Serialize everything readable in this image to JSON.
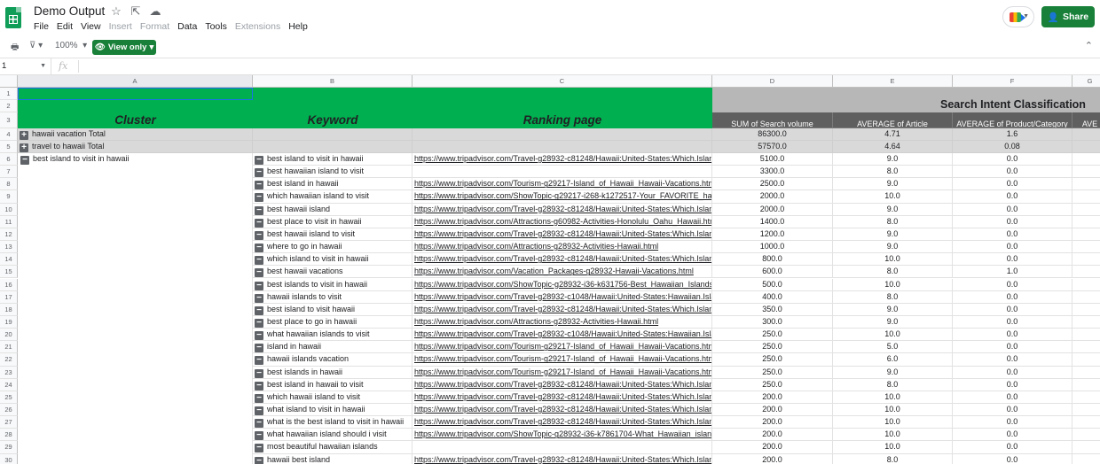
{
  "app": {
    "doc_title": "Demo Output",
    "menus": [
      {
        "label": "File",
        "enabled": true
      },
      {
        "label": "Edit",
        "enabled": true
      },
      {
        "label": "View",
        "enabled": true
      },
      {
        "label": "Insert",
        "enabled": false
      },
      {
        "label": "Format",
        "enabled": false
      },
      {
        "label": "Data",
        "enabled": true
      },
      {
        "label": "Tools",
        "enabled": true
      },
      {
        "label": "Extensions",
        "enabled": false
      },
      {
        "label": "Help",
        "enabled": true
      }
    ],
    "share_label": "Share",
    "accent": "#188038"
  },
  "toolbar": {
    "zoom": "100%",
    "view_only_label": "View only"
  },
  "formula_bar": {
    "name_box": "1",
    "fx": "fx"
  },
  "columns": [
    "A",
    "B",
    "C",
    "D",
    "E",
    "F",
    "G"
  ],
  "headers": {
    "cluster": "Cluster",
    "keyword": "Keyword",
    "ranking_page": "Ranking page",
    "search_intent": "Search Intent Classification",
    "metrics": [
      "SUM of Search volume",
      "AVERAGE of Article",
      "AVERAGE of Product/Category",
      "AVE"
    ]
  },
  "totals": [
    {
      "row": "4",
      "cluster": "hawaii vacation Total",
      "volume": "86300.0",
      "article": "4.71",
      "product": "1.6"
    },
    {
      "row": "5",
      "cluster": "travel to hawaii Total",
      "volume": "57570.0",
      "article": "4.64",
      "product": "0.08"
    }
  ],
  "cluster_name": "best island to visit in hawaii",
  "rows": [
    {
      "row": "6",
      "keyword": "best island to visit in hawaii",
      "page": "https://www.tripadvisor.com/Travel-g28932-c81248/Hawaii:United-States:Which.Islan",
      "volume": "5100.0",
      "article": "9.0",
      "product": "0.0"
    },
    {
      "row": "7",
      "keyword": "best hawaiian island to visit",
      "page": "",
      "volume": "3300.0",
      "article": "8.0",
      "product": "0.0"
    },
    {
      "row": "8",
      "keyword": "best island in hawaii",
      "page": "https://www.tripadvisor.com/Tourism-g29217-Island_of_Hawaii_Hawaii-Vacations.htm",
      "volume": "2500.0",
      "article": "9.0",
      "product": "0.0"
    },
    {
      "row": "9",
      "keyword": "which hawaiian island to visit",
      "page": "https://www.tripadvisor.com/ShowTopic-g29217-i268-k1272517-Your_FAVORITE_ha",
      "volume": "2000.0",
      "article": "10.0",
      "product": "0.0"
    },
    {
      "row": "10",
      "keyword": "best hawaii island",
      "page": "https://www.tripadvisor.com/Travel-g28932-c81248/Hawaii:United-States:Which.Islan",
      "volume": "2000.0",
      "article": "9.0",
      "product": "0.0"
    },
    {
      "row": "11",
      "keyword": "best place to visit in hawaii",
      "page": "https://www.tripadvisor.com/Attractions-g60982-Activities-Honolulu_Oahu_Hawaii.htm",
      "volume": "1400.0",
      "article": "8.0",
      "product": "0.0"
    },
    {
      "row": "12",
      "keyword": "best hawaii island to visit",
      "page": "https://www.tripadvisor.com/Travel-g28932-c81248/Hawaii:United-States:Which.Islan",
      "volume": "1200.0",
      "article": "9.0",
      "product": "0.0"
    },
    {
      "row": "13",
      "keyword": "where to go in hawaii",
      "page": "https://www.tripadvisor.com/Attractions-g28932-Activities-Hawaii.html",
      "volume": "1000.0",
      "article": "9.0",
      "product": "0.0"
    },
    {
      "row": "14",
      "keyword": "which island to visit in hawaii",
      "page": "https://www.tripadvisor.com/Travel-g28932-c81248/Hawaii:United-States:Which.Islan",
      "volume": "800.0",
      "article": "10.0",
      "product": "0.0"
    },
    {
      "row": "15",
      "keyword": "best hawaii vacations",
      "page": "https://www.tripadvisor.com/Vacation_Packages-g28932-Hawaii-Vacations.html",
      "volume": "600.0",
      "article": "8.0",
      "product": "1.0"
    },
    {
      "row": "16",
      "keyword": "best islands to visit in hawaii",
      "page": "https://www.tripadvisor.com/ShowTopic-g28932-i36-k631756-Best_Hawaiian_Islands",
      "volume": "500.0",
      "article": "10.0",
      "product": "0.0"
    },
    {
      "row": "17",
      "keyword": "hawaii islands to visit",
      "page": "https://www.tripadvisor.com/Travel-g28932-c1048/Hawaii:United-States:Hawaiian.Isla",
      "volume": "400.0",
      "article": "8.0",
      "product": "0.0"
    },
    {
      "row": "18",
      "keyword": "best island to visit hawaii",
      "page": "https://www.tripadvisor.com/Travel-g28932-c81248/Hawaii:United-States:Which.Islan",
      "volume": "350.0",
      "article": "9.0",
      "product": "0.0"
    },
    {
      "row": "19",
      "keyword": "best place to go in hawaii",
      "page": "https://www.tripadvisor.com/Attractions-g28932-Activities-Hawaii.html",
      "volume": "300.0",
      "article": "9.0",
      "product": "0.0"
    },
    {
      "row": "20",
      "keyword": "what hawaiian islands to visit",
      "page": "https://www.tripadvisor.com/Travel-g28932-c1048/Hawaii:United-States:Hawaiian.Isla",
      "volume": "250.0",
      "article": "10.0",
      "product": "0.0"
    },
    {
      "row": "21",
      "keyword": "island in hawaii",
      "page": "https://www.tripadvisor.com/Tourism-g29217-Island_of_Hawaii_Hawaii-Vacations.htm",
      "volume": "250.0",
      "article": "5.0",
      "product": "0.0"
    },
    {
      "row": "22",
      "keyword": "hawaii islands vacation",
      "page": "https://www.tripadvisor.com/Tourism-g29217-Island_of_Hawaii_Hawaii-Vacations.htm",
      "volume": "250.0",
      "article": "6.0",
      "product": "0.0"
    },
    {
      "row": "23",
      "keyword": "best islands in hawaii",
      "page": "https://www.tripadvisor.com/Tourism-g29217-Island_of_Hawaii_Hawaii-Vacations.htm",
      "volume": "250.0",
      "article": "9.0",
      "product": "0.0"
    },
    {
      "row": "24",
      "keyword": "best island in hawaii to visit",
      "page": "https://www.tripadvisor.com/Travel-g28932-c81248/Hawaii:United-States:Which.Islan",
      "volume": "250.0",
      "article": "8.0",
      "product": "0.0"
    },
    {
      "row": "25",
      "keyword": "which hawaii island to visit",
      "page": "https://www.tripadvisor.com/Travel-g28932-c81248/Hawaii:United-States:Which.Islan",
      "volume": "200.0",
      "article": "10.0",
      "product": "0.0"
    },
    {
      "row": "26",
      "keyword": "what island to visit in hawaii",
      "page": "https://www.tripadvisor.com/Travel-g28932-c81248/Hawaii:United-States:Which.Islan",
      "volume": "200.0",
      "article": "10.0",
      "product": "0.0"
    },
    {
      "row": "27",
      "keyword": "what is the best island to visit in hawaii",
      "page": "https://www.tripadvisor.com/Travel-g28932-c81248/Hawaii:United-States:Which.Islan",
      "volume": "200.0",
      "article": "10.0",
      "product": "0.0"
    },
    {
      "row": "28",
      "keyword": "what hawaiian island should i visit",
      "page": "https://www.tripadvisor.com/ShowTopic-g28932-i36-k7861704-What_Hawaiian_island",
      "volume": "200.0",
      "article": "10.0",
      "product": "0.0"
    },
    {
      "row": "29",
      "keyword": "most beautiful hawaiian islands",
      "page": "",
      "volume": "200.0",
      "article": "10.0",
      "product": "0.0"
    },
    {
      "row": "30",
      "keyword": "hawaii best island",
      "page": "https://www.tripadvisor.com/Travel-g28932-c81248/Hawaii:United-States:Which.Islan",
      "volume": "200.0",
      "article": "8.0",
      "product": "0.0"
    }
  ],
  "header_rows": [
    "1",
    "2",
    "3"
  ]
}
